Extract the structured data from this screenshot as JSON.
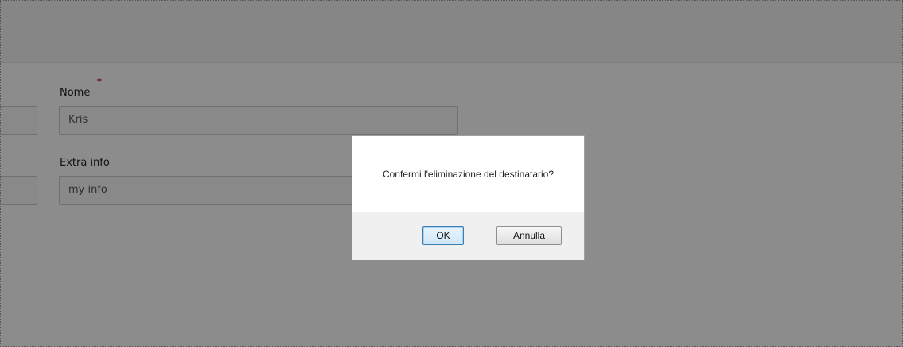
{
  "form": {
    "name_label": "Nome",
    "name_required_mark": "*",
    "name_value": "Kris",
    "extra_label": "Extra info",
    "extra_value": "my info"
  },
  "dialog": {
    "message": "Confermi l'eliminazione del destinatario?",
    "ok_label": "OK",
    "cancel_label": "Annulla"
  },
  "colors": {
    "overlay": "#8c8c8c",
    "required": "#cc0000",
    "default_button_border": "#3c7fb1"
  }
}
